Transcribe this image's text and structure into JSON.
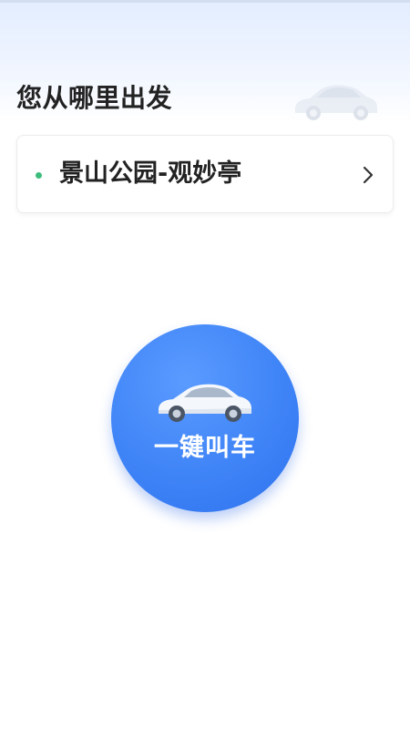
{
  "header": {
    "title": "您从哪里出发",
    "car_icon": "car-icon"
  },
  "origin": {
    "location": "景山公园-观妙亭",
    "dot_color": "#3dbd7d",
    "chevron_icon": "chevron-right-icon"
  },
  "call_button": {
    "label": "一键叫车",
    "car_icon": "car-icon",
    "color": "#3f84f7"
  }
}
